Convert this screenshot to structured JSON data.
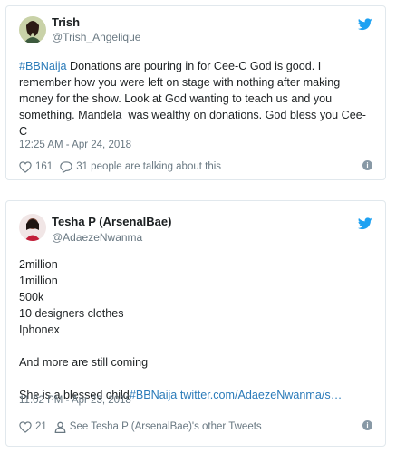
{
  "tweets": [
    {
      "name": "Trish",
      "handle": "@Trish_Angelique",
      "hashtag": "#BBNaija",
      "text": " Donations are pouring in for Cee-C God is good. I remember how you were left on stage with nothing after making money for the show. Look at God wanting to teach us and you something. Mandela  was wealthy on donations. God bless you Cee-C",
      "timestamp": "12:25 AM - Apr 24, 2018",
      "likes": "161",
      "talking": "31 people are talking about this",
      "icons": [
        "avatar",
        "twitter-bird-icon",
        "heart-icon",
        "comment-bubble-icon",
        "info-icon"
      ]
    },
    {
      "name": "Tesha P (ArsenalBae)",
      "handle": "@AdaezeNwanma",
      "lines": "2million\n1million\n500k\n10 designers clothes\nIphonex\n\nAnd more are still coming\n\nShe is a blessed child",
      "hashtag": "#BBNaija",
      "link": " twitter.com/AdaezeNwanma/s…",
      "timestamp": "11:02 PM - Apr 23, 2018",
      "likes": "21",
      "other_tweets": "See Tesha P (ArsenalBae)'s other Tweets",
      "icons": [
        "avatar",
        "twitter-bird-icon",
        "heart-icon",
        "person-icon",
        "info-icon"
      ]
    }
  ],
  "colors": {
    "accent": "#2b7bb9",
    "bird": "#1da1f2",
    "muted": "#697882",
    "border": "#e1e8ed"
  }
}
